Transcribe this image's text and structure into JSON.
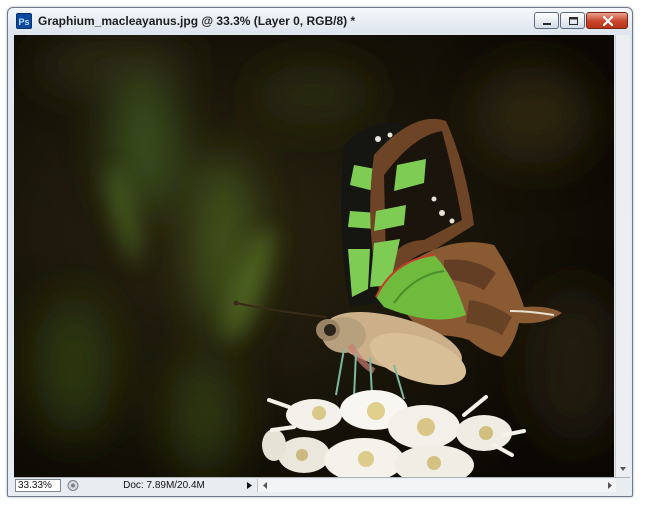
{
  "window": {
    "title": "Graphium_macleayanus.jpg @ 33.3% (Layer 0, RGB/8) *",
    "app_icon_label": "Ps"
  },
  "status_bar": {
    "zoom": "33.33%",
    "doc_info": "Doc: 7.89M/20.4M"
  },
  "icons": [
    "photoshop-icon",
    "minimize-icon",
    "maximize-icon",
    "close-icon",
    "zoom-options-icon",
    "status-menu-arrow-icon",
    "scroll-left-icon",
    "scroll-right-icon",
    "scroll-down-icon"
  ],
  "colors": {
    "close_button": "#c9452b",
    "wing_green": "#7fcc55",
    "wing_brown": "#7a4a2a"
  }
}
